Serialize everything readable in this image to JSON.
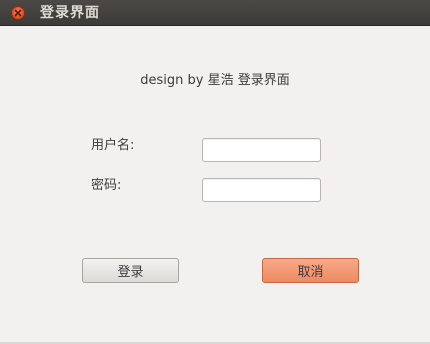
{
  "window": {
    "title": "登录界面"
  },
  "content": {
    "credit": "design by 星浩 登录界面"
  },
  "form": {
    "username_label": "用户名:",
    "username_value": "",
    "password_label": "密码:",
    "password_value": ""
  },
  "buttons": {
    "login_label": "登录",
    "cancel_label": "取消"
  },
  "colors": {
    "titlebar": "#3c3b37",
    "window_bg": "#f2f1f0",
    "close_button": "#e0532a",
    "cancel_accent": "#ee8a62"
  },
  "icons": {
    "close": "close-icon"
  }
}
